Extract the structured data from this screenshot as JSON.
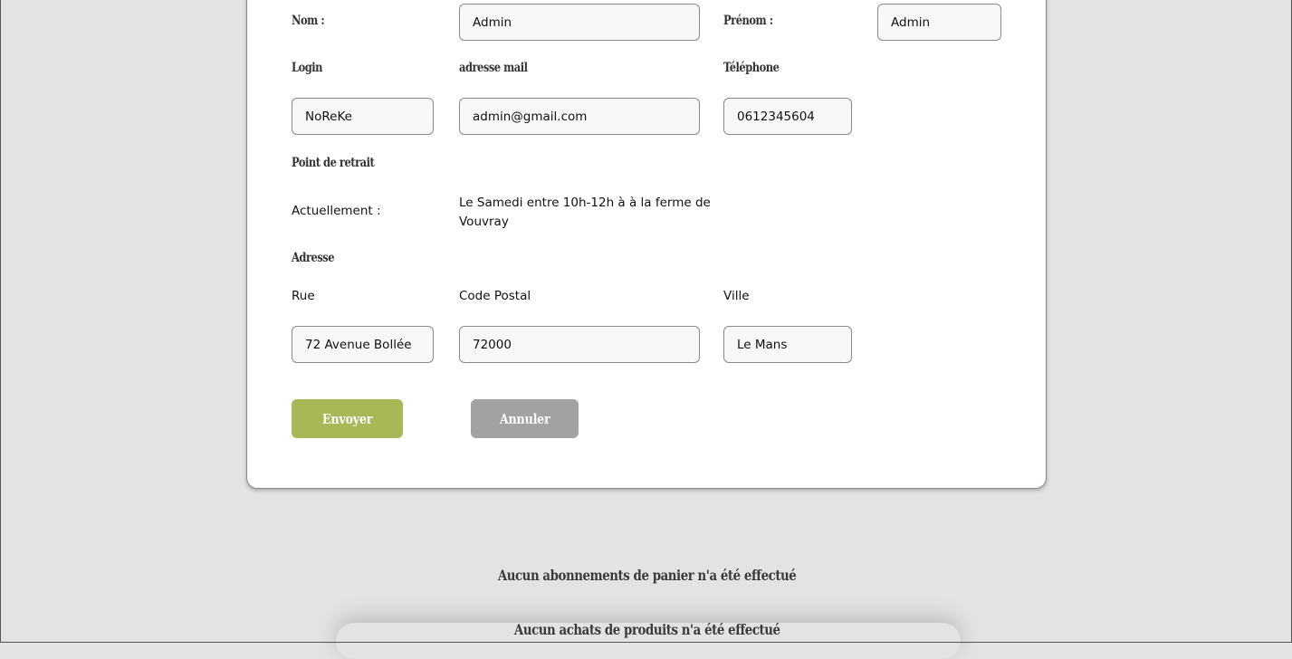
{
  "labels": {
    "nom": "Nom :",
    "prenom": "Prénom :",
    "login": "Login",
    "email": "adresse mail",
    "telephone": "Téléphone",
    "point_retrait": "Point de retrait",
    "actuellement": "Actuellement :",
    "adresse": "Adresse",
    "rue": "Rue",
    "code_postal": "Code Postal",
    "ville": "Ville"
  },
  "values": {
    "nom": "Admin",
    "prenom": "Admin",
    "login": "NoReKe",
    "email": "admin@gmail.com",
    "telephone": "0612345604",
    "retrait_line1": "Le Samedi entre 10h-12h à à la ferme de",
    "retrait_line2": "Vouvray",
    "rue": "72 Avenue Bollée",
    "code_postal": "72000",
    "ville": "Le Mans"
  },
  "buttons": {
    "envoyer": "Envoyer",
    "annuler": "Annuler"
  },
  "colors": {
    "envoyer": "#a8b856",
    "annuler": "#a2a2a2"
  },
  "messages": {
    "abonnements": "Aucun abonnements de panier n'a été effectué",
    "achats": "Aucun achats de produits n'a été effectué"
  }
}
